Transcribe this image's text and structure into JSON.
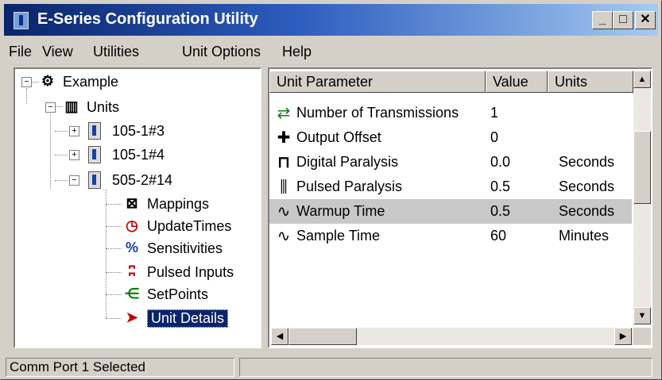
{
  "window": {
    "title": "E-Series Configuration Utility"
  },
  "caption_buttons": {
    "minimize": "_",
    "maximize": "□",
    "close": "✕"
  },
  "menu": {
    "file": "File",
    "view": "View",
    "utilities": "Utilities",
    "unit_options": "Unit Options",
    "help": "Help"
  },
  "tree": {
    "root": "Example",
    "units": "Units",
    "unit_a": "105-1#3",
    "unit_b": "105-1#4",
    "unit_c": "505-2#14",
    "children": {
      "mappings": "Mappings",
      "update_times": "UpdateTimes",
      "sensitivities": "Sensitivities",
      "pulsed_inputs": "Pulsed Inputs",
      "setpoints": "SetPoints",
      "unit_details": "Unit Details"
    }
  },
  "list": {
    "headers": {
      "parameter": "Unit Parameter",
      "value": "Value",
      "units": "Units"
    },
    "rows": [
      {
        "name": "Number of Transmissions",
        "value": "1",
        "units": "",
        "icon": "transmissions-icon"
      },
      {
        "name": "Output Offset",
        "value": "0",
        "units": "",
        "icon": "plus-offset-icon"
      },
      {
        "name": "Digital Paralysis",
        "value": "0.0",
        "units": "Seconds",
        "icon": "digital-pulse-icon"
      },
      {
        "name": "Pulsed Paralysis",
        "value": "0.5",
        "units": "Seconds",
        "icon": "pulsed-wave-icon"
      },
      {
        "name": "Warmup Time",
        "value": "0.5",
        "units": "Seconds",
        "icon": "sine-wave-icon",
        "highlighted": true
      },
      {
        "name": "Sample Time",
        "value": "60",
        "units": "Minutes",
        "icon": "sine-wave-icon"
      }
    ]
  },
  "status": {
    "text": "Comm Port 1 Selected",
    "panel2": ""
  },
  "colors": {
    "titlebar_start": "#0a246a",
    "titlebar_end": "#a6caf0",
    "selection": "#0a246a",
    "highlight_row": "#c8c8c8"
  }
}
